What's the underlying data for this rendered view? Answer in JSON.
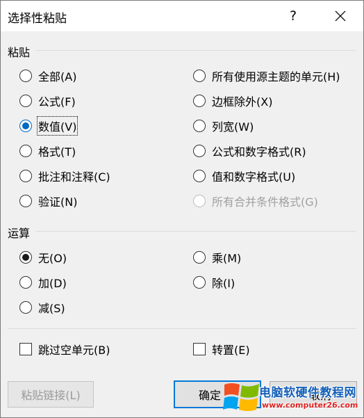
{
  "dialog": {
    "title": "选择性粘贴",
    "help": "?"
  },
  "paste": {
    "label": "粘贴",
    "options_left": [
      "全部(A)",
      "公式(F)",
      "数值(V)",
      "格式(T)",
      "批注和注释(C)",
      "验证(N)"
    ],
    "options_right": [
      "所有使用源主题的单元(H)",
      "边框除外(X)",
      "列宽(W)",
      "公式和数字格式(R)",
      "值和数字格式(U)",
      "所有合并条件格式(G)"
    ],
    "selected": "数值(V)"
  },
  "operation": {
    "label": "运算",
    "options_left": [
      "无(O)",
      "加(D)",
      "减(S)"
    ],
    "options_right": [
      "乘(M)",
      "除(I)"
    ],
    "selected": "无(O)"
  },
  "checkboxes": {
    "skip_blanks": "跳过空单元(B)",
    "transpose": "转置(E)"
  },
  "buttons": {
    "paste_link": "粘贴链接(L)",
    "ok": "确定",
    "cancel": "取消"
  },
  "watermark": {
    "line1": "电脑软硬件教程网",
    "line2": "www.computer26.com"
  },
  "colors": {
    "accent": "#0067c0",
    "titlebar": "#ffffff",
    "body": "#f0f0f0"
  }
}
